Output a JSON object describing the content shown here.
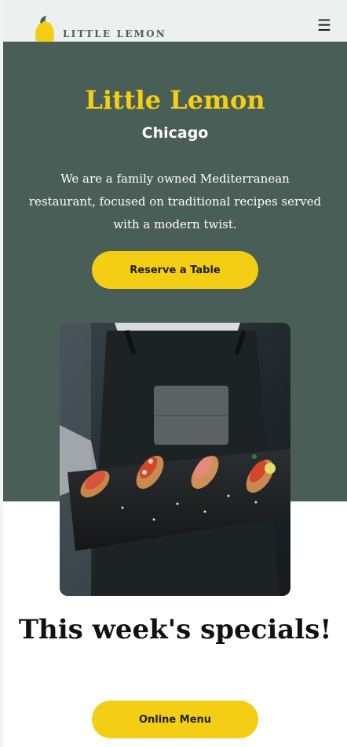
{
  "header": {
    "brand": "LITTLE LEMON",
    "logo_icon": "lemon-icon",
    "menu_icon": "hamburger-menu-icon"
  },
  "hero": {
    "title": "Little Lemon",
    "city": "Chicago",
    "description": "We are a family owned Mediterranean restaurant, focused on traditional recipes served with a modern twist.",
    "reserve_label": "Reserve a Table",
    "image_alt": "Waiter holding a slate with bruschetta"
  },
  "specials": {
    "title": "This week's specials!",
    "menu_label": "Online Menu"
  },
  "colors": {
    "primary_green": "#495e57",
    "primary_yellow": "#f4ce14",
    "header_bg": "#eef0ef"
  }
}
